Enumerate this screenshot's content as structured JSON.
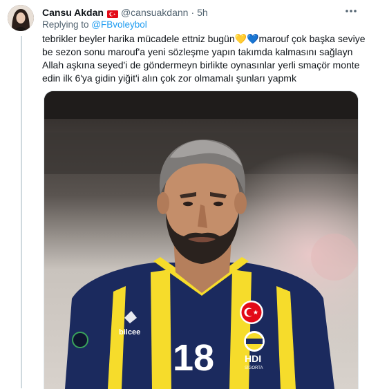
{
  "tweet": {
    "author_name": "Cansu Akdan",
    "flag_icon": "turkey-flag-icon",
    "handle": "@cansuakdann",
    "separator": "·",
    "time": "5h",
    "replying_prefix": "Replying to",
    "replying_mention": "@FBvoleybol",
    "text_lines": [
      "tebrikler beyler harika mücadele ettniz bugün💛💙marouf çok başka seviye",
      "be  sezon sonu marouf'a yeni sözleşme yapın takımda kalmasını sağlayn",
      "Allah aşkına seyed'i de göndermeyn birlikte oynasınlar yerli smaçör monte",
      "edin ilk 6'ya gidin yiğit'i alın çok zor olmamalı şunları yapmk"
    ],
    "media_icon": "volleyball-player-photo"
  },
  "photo": {
    "jersey_number": "18",
    "sponsor_brand": "bilcee",
    "sponsor_sub": "HDI",
    "sponsor_tag": "SİGORTA"
  },
  "colors": {
    "link": "#1d9bf0",
    "secondary_text": "#536471",
    "jersey_navy": "#1b2a5e",
    "jersey_yellow": "#f6dc2b"
  }
}
